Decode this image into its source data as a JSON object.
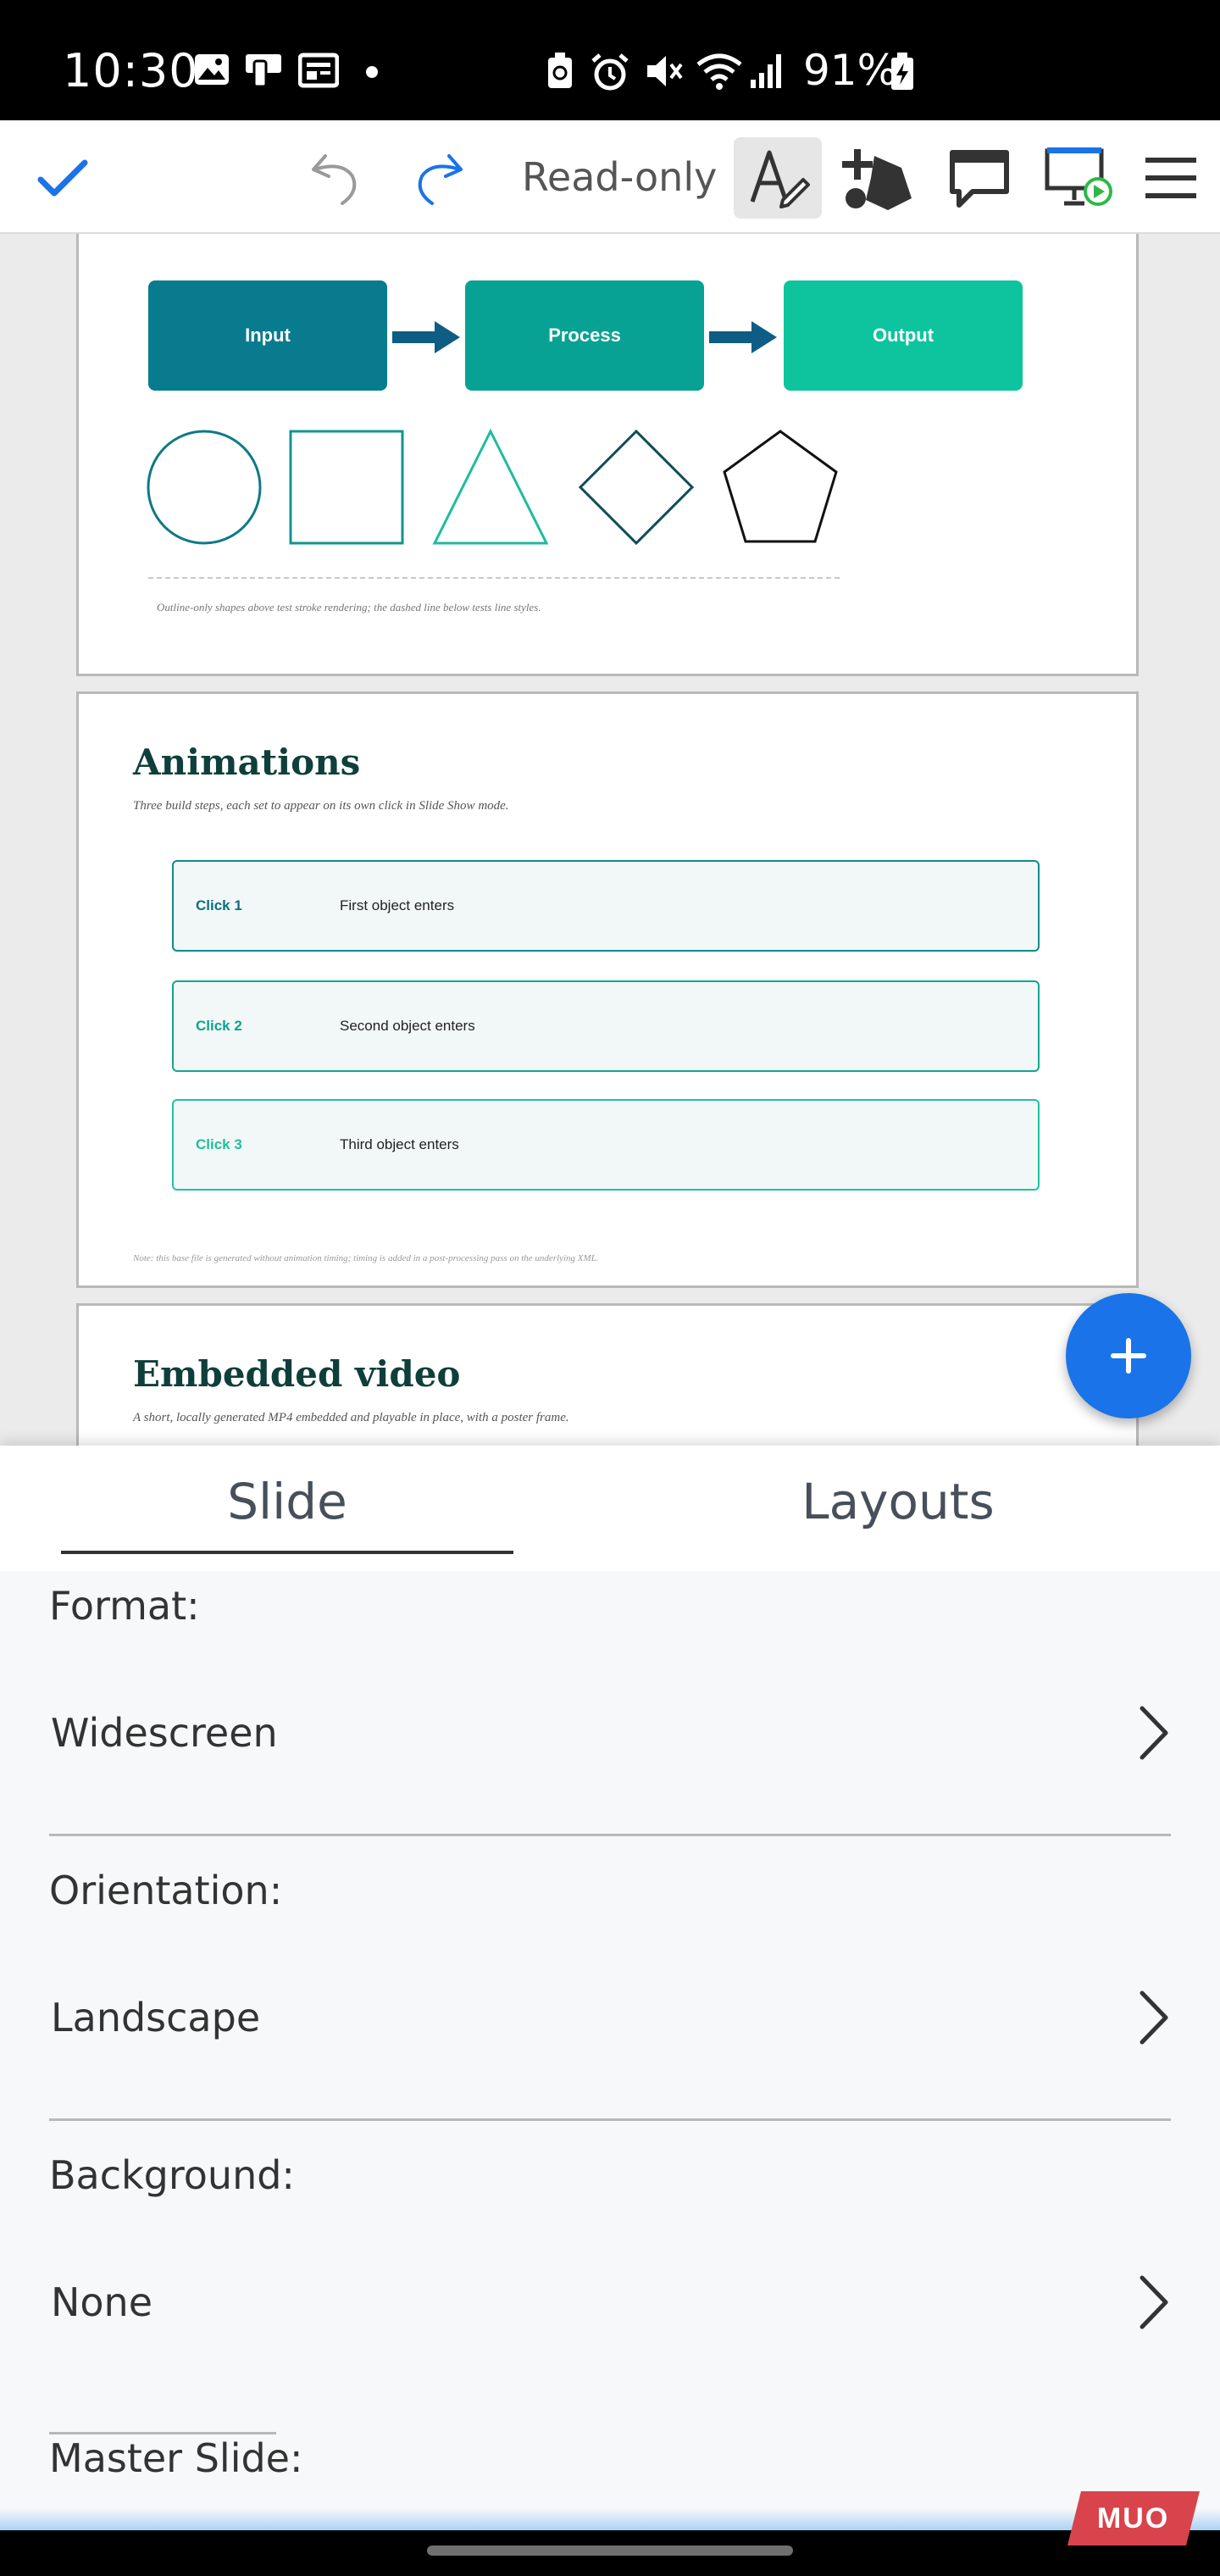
{
  "status_bar": {
    "time": "10:30",
    "battery": "91%"
  },
  "toolbar": {
    "mode_label": "Read-only"
  },
  "slides": {
    "slide1": {
      "flow": [
        "Input",
        "Process",
        "Output"
      ],
      "caption": "Outline-only shapes above test stroke rendering; the dashed line below tests line styles."
    },
    "slide2": {
      "title": "Animations",
      "subtitle": "Three build steps, each set to appear on its own click in Slide Show mode.",
      "steps": [
        {
          "label": "Click 1",
          "text": "First object enters"
        },
        {
          "label": "Click 2",
          "text": "Second object enters"
        },
        {
          "label": "Click 3",
          "text": "Third object enters"
        }
      ],
      "note": "Note: this base file is generated without animation timing; timing is added in a post-processing pass on the underlying XML."
    },
    "slide3": {
      "title": "Embedded video",
      "subtitle": "A short, locally generated MP4 embedded and playable in place, with a poster frame."
    }
  },
  "panel": {
    "tabs": [
      "Slide",
      "Layouts"
    ],
    "format": {
      "label": "Format:",
      "value": "Widescreen"
    },
    "orientation": {
      "label": "Orientation:",
      "value": "Landscape"
    },
    "background": {
      "label": "Background:",
      "value": "None"
    },
    "master": {
      "label": "Master Slide:"
    }
  },
  "watermark": "MUO",
  "colors": {
    "accent": "#1a73e8",
    "teal_dark": "#087c8e",
    "teal_mid": "#07a293",
    "teal_light": "#0ec49e"
  }
}
